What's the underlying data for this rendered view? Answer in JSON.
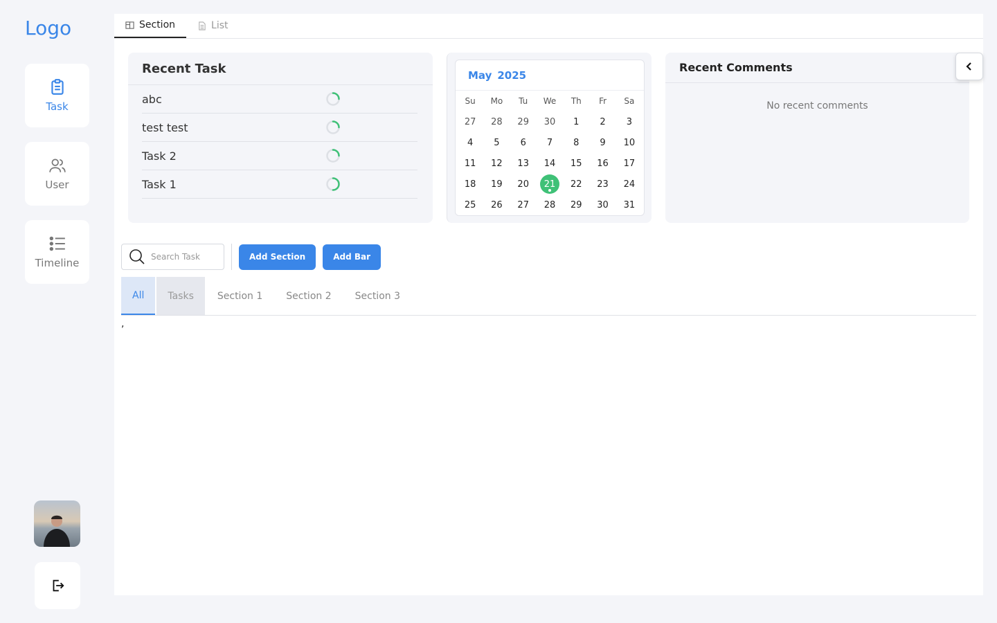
{
  "app": {
    "logo": "Logo"
  },
  "sidebar": {
    "items": [
      {
        "label": "Task",
        "icon": "clipboard-icon",
        "active": true
      },
      {
        "label": "User",
        "icon": "users-icon",
        "active": false
      },
      {
        "label": "Timeline",
        "icon": "list-icon",
        "active": false
      }
    ]
  },
  "view_tabs": [
    {
      "label": "Section",
      "icon": "layout-icon",
      "active": true
    },
    {
      "label": "List",
      "icon": "document-icon",
      "active": false
    }
  ],
  "recent_task": {
    "title": "Recent Task",
    "tasks": [
      {
        "name": "abc"
      },
      {
        "name": "test test"
      },
      {
        "name": "Task 2"
      },
      {
        "name": "Task 1"
      }
    ]
  },
  "calendar": {
    "month": "May",
    "year": "2025",
    "weekdays": [
      "Su",
      "Mo",
      "Tu",
      "We",
      "Th",
      "Fr",
      "Sa"
    ],
    "days": [
      "27",
      "28",
      "29",
      "30",
      "1",
      "2",
      "3",
      "4",
      "5",
      "6",
      "7",
      "8",
      "9",
      "10",
      "11",
      "12",
      "13",
      "14",
      "15",
      "16",
      "17",
      "18",
      "19",
      "20",
      "21",
      "22",
      "23",
      "24",
      "25",
      "26",
      "27",
      "28",
      "29",
      "30",
      "31"
    ],
    "leading_other_month": 4,
    "selected_day": "21"
  },
  "comments": {
    "title": "Recent Comments",
    "empty_text": "No recent comments"
  },
  "toolbar": {
    "search_placeholder": "Search Task",
    "add_section_label": "Add Section",
    "add_bar_label": "Add Bar"
  },
  "section_tabs": [
    {
      "label": "All",
      "state": "active"
    },
    {
      "label": "Tasks",
      "state": "hover"
    },
    {
      "label": "Section 1",
      "state": "normal"
    },
    {
      "label": "Section 2",
      "state": "normal"
    },
    {
      "label": "Section 3",
      "state": "normal"
    }
  ],
  "content": {
    "text": ","
  },
  "colors": {
    "accent": "#3a86e8",
    "success": "#3fc177",
    "background": "#f4f5f9"
  }
}
